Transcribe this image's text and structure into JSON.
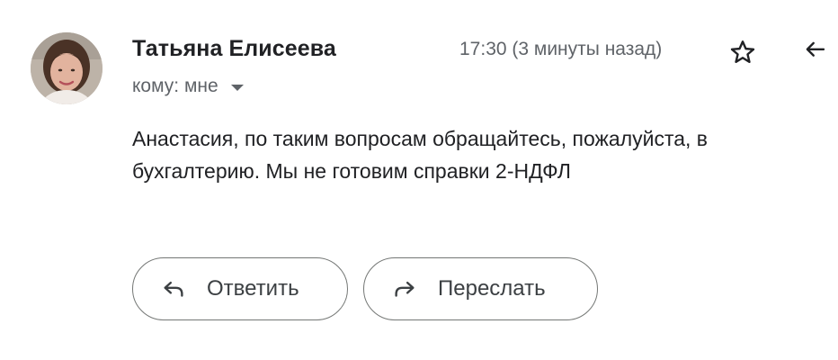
{
  "sender": {
    "name": "Татьяна Елисеева",
    "recipient_label": "кому: мне"
  },
  "timestamp": "17:30 (3 минуты назад)",
  "icons": {
    "star": "star-outline-icon",
    "reply": "reply-arrow-icon",
    "forward": "forward-arrow-icon",
    "dropdown": "caret-down-icon"
  },
  "body": {
    "line1": "Анастасия, по таким вопросам обращайтесь, пожалуйста, в",
    "line2": "бухгалтерию. Мы не готовим справки 2-НДФЛ"
  },
  "actions": {
    "reply_label": "Ответить",
    "forward_label": "Переслать"
  },
  "colors": {
    "text_primary": "#202124",
    "text_secondary": "#5f6368",
    "button_border": "#747775"
  }
}
